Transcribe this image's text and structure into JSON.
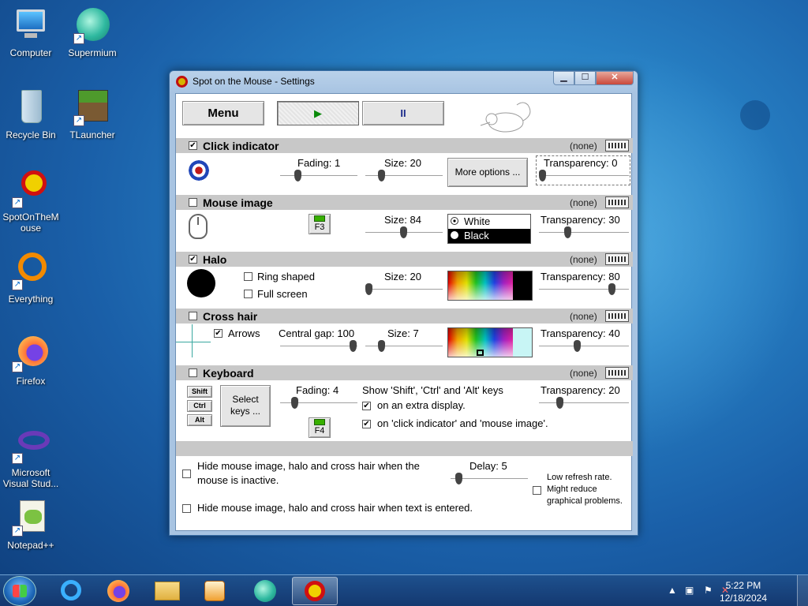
{
  "desktop": {
    "icons": [
      {
        "label": "Computer"
      },
      {
        "label": "Supermium"
      },
      {
        "label": "Recycle Bin"
      },
      {
        "label": "TLauncher"
      },
      {
        "label": "SpotOnTheMouse"
      },
      {
        "label": "Everything"
      },
      {
        "label": "Firefox"
      },
      {
        "label": "Microsoft Visual Stud..."
      },
      {
        "label": "Notepad++"
      }
    ]
  },
  "window": {
    "title": "Spot on the Mouse - Settings",
    "minimize_label": "▁",
    "maximize_label": "☐",
    "close_label": "✕",
    "toolbar": {
      "menu_label": "Menu",
      "play_label": "▶",
      "pause_label": "II"
    },
    "click_indicator": {
      "header": "Click indicator",
      "checked": true,
      "shortcut": "(none)",
      "fading_label": "Fading: 1",
      "size_label": "Size: 20",
      "more_options_label": "More options ...",
      "transparency_label": "Transparency: 0",
      "fading": 1,
      "size": 20,
      "transparency": 0
    },
    "mouse_image": {
      "header": "Mouse image",
      "checked": false,
      "shortcut": "(none)",
      "hotkey": "F3",
      "size_label": "Size: 84",
      "options": [
        "White",
        "Black"
      ],
      "selected": "White",
      "transparency_label": "Transparency: 30",
      "size": 84,
      "transparency": 30
    },
    "halo": {
      "header": "Halo",
      "checked": true,
      "shortcut": "(none)",
      "ring_shaped_label": "Ring shaped",
      "full_screen_label": "Full screen",
      "size_label": "Size: 20",
      "transparency_label": "Transparency: 80",
      "size": 20,
      "transparency": 80,
      "color": "#000000"
    },
    "cross_hair": {
      "header": "Cross hair",
      "checked": false,
      "shortcut": "(none)",
      "arrows_label": "Arrows",
      "arrows_checked": true,
      "gap_label": "Central gap: 100",
      "size_label": "Size: 7",
      "transparency_label": "Transparency: 40",
      "gap": 100,
      "size": 7,
      "transparency": 40,
      "color": "#c8f5f5"
    },
    "keyboard": {
      "header": "Keyboard",
      "checked": false,
      "shortcut": "(none)",
      "keys": [
        "Shift",
        "Ctrl",
        "Alt"
      ],
      "select_keys_label": "Select keys ...",
      "fading_label": "Fading: 4",
      "hotkey": "F4",
      "show_label": "Show 'Shift', 'Ctrl' and 'Alt' keys",
      "extra_display_label": "on an extra display.",
      "click_indicator_label": "on 'click indicator' and 'mouse image'.",
      "transparency_label": "Transparency: 20",
      "fading": 4,
      "transparency": 20
    },
    "bottom": {
      "hide_inactive_label_1": "Hide mouse image, halo and cross hair when the",
      "hide_inactive_label_2": "mouse is inactive.",
      "delay_label": "Delay: 5",
      "hide_text_label": "Hide mouse image, halo and cross hair when text is entered.",
      "low_refresh_1": "Low refresh rate.",
      "low_refresh_2": "Might reduce",
      "low_refresh_3": "graphical problems.",
      "delay": 5
    }
  },
  "taskbar": {
    "time": "5:22 PM",
    "date": "12/18/2024"
  },
  "colors": {
    "accent": "#3a6ea5",
    "section_header": "#c8c8c8"
  }
}
